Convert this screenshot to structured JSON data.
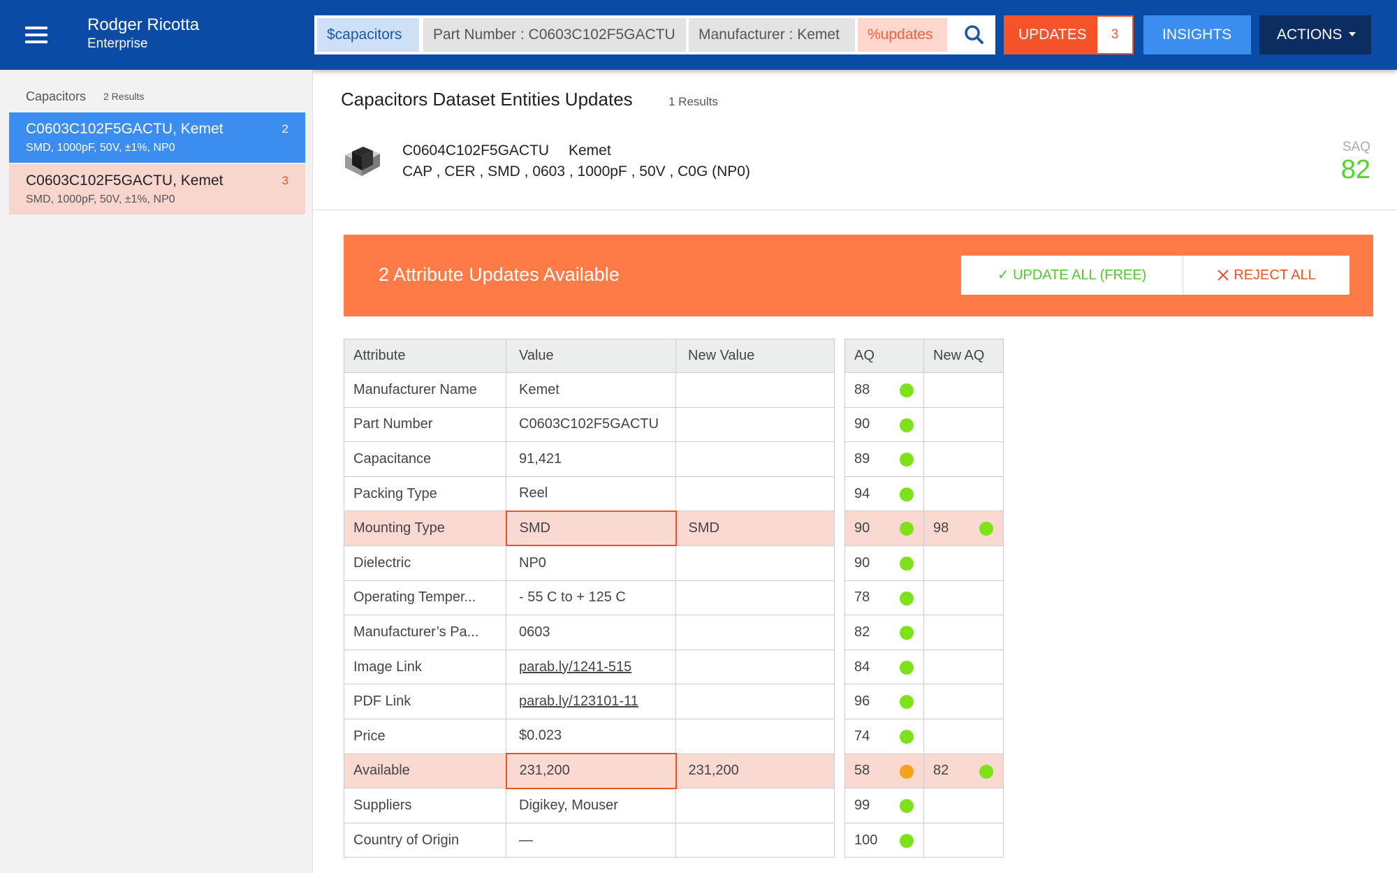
{
  "header": {
    "user_name": "Rodger Ricotta",
    "user_org": "Enterprise",
    "search": {
      "chip_category": "$capacitors",
      "chip_part_number": "Part Number : C0603C102F5GACTU",
      "chip_manufacturer": "Manufacturer : Kemet",
      "chip_updates": "%updates"
    },
    "updates_label": "UPDATES",
    "updates_count": "3",
    "insights_label": "INSIGHTS",
    "actions_label": "ACTIONS"
  },
  "sidebar": {
    "title": "Capacitors",
    "count": "2 Results",
    "items": [
      {
        "title": "C0603C102F5GACTU, Kemet",
        "subtitle": "SMD, 1000pF, 50V, ±1%, NP0",
        "count": "2"
      },
      {
        "title": "C0603C102F5GACTU, Kemet",
        "subtitle": "SMD, 1000pF, 50V, ±1%, NP0",
        "count": "3"
      }
    ]
  },
  "main": {
    "title": "Capacitors Dataset Entities Updates",
    "count": "1 Results",
    "entity": {
      "part_number": "C0604C102F5GACTU",
      "manufacturer": "Kemet",
      "spec": "CAP , CER , SMD , 0603 , 1000pF , 50V , C0G (NP0)"
    },
    "saq_label": "SAQ",
    "saq_value": "82",
    "banner": {
      "text": "2 Attribute Updates Available",
      "update_all": "✓ UPDATE ALL (FREE)",
      "reject_all": "REJECT ALL"
    },
    "table_headers": {
      "attribute": "Attribute",
      "value": "Value",
      "new_value": "New Value",
      "aq": "AQ",
      "new_aq": "New AQ"
    },
    "rows": [
      {
        "attribute": "Manufacturer Name",
        "value": "Kemet",
        "new_value": "",
        "aq": "88",
        "new_aq": ""
      },
      {
        "attribute": "Part Number",
        "value": "C0603C102F5GACTU",
        "new_value": "",
        "aq": "90",
        "new_aq": ""
      },
      {
        "attribute": "Capacitance",
        "value": "91,421",
        "new_value": "",
        "aq": "89",
        "new_aq": ""
      },
      {
        "attribute": "Packing Type",
        "value": "Reel",
        "new_value": "",
        "aq": "94",
        "new_aq": ""
      },
      {
        "attribute": "Mounting Type",
        "value": "SMD",
        "new_value": "SMD",
        "aq": "90",
        "new_aq": "98"
      },
      {
        "attribute": "Dielectric",
        "value": "NP0",
        "new_value": "",
        "aq": "90",
        "new_aq": ""
      },
      {
        "attribute": "Operating Temper...",
        "value": "- 55 C to + 125 C",
        "new_value": "",
        "aq": "78",
        "new_aq": ""
      },
      {
        "attribute": "Manufacturer’s Pa...",
        "value": "0603",
        "new_value": "",
        "aq": "82",
        "new_aq": ""
      },
      {
        "attribute": "Image Link",
        "value": "parab.ly/1241-515",
        "new_value": "",
        "aq": "84",
        "new_aq": ""
      },
      {
        "attribute": "PDF Link",
        "value": "parab.ly/123101-11",
        "new_value": "",
        "aq": "96",
        "new_aq": ""
      },
      {
        "attribute": "Price",
        "value": "$0.023",
        "new_value": "",
        "aq": "74",
        "new_aq": ""
      },
      {
        "attribute": "Available",
        "value": "231,200",
        "new_value": "231,200",
        "aq": "58",
        "new_aq": "82"
      },
      {
        "attribute": "Suppliers",
        "value": "Digikey, Mouser",
        "new_value": "",
        "aq": "99",
        "new_aq": ""
      },
      {
        "attribute": "Country of Origin",
        "value": "—",
        "new_value": "",
        "aq": "100",
        "new_aq": ""
      }
    ]
  },
  "colors": {
    "header_bg": "#0a4ba6",
    "updates_orange": "#f5532a",
    "banner_orange": "#fe7a46",
    "insights_blue": "#3b8def",
    "actions_navy": "#0c2d60",
    "quality_green": "#7ee21b",
    "quality_orange": "#f7a21b",
    "saq_green": "#53d22a"
  },
  "icons": [
    "menu-icon",
    "search-icon",
    "dropdown-caret-icon",
    "component-chip-icon",
    "check-icon",
    "close-icon"
  ]
}
